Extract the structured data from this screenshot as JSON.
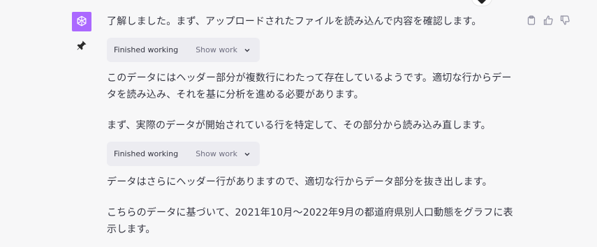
{
  "assistant": {
    "avatar_icon": "openai-logo-icon",
    "avatar_color": "#ab68ff",
    "pin_icon": "pin-icon"
  },
  "message_actions": [
    {
      "icon": "clipboard-icon"
    },
    {
      "icon": "thumbs-up-icon"
    },
    {
      "icon": "thumbs-down-icon"
    }
  ],
  "messages": {
    "p1": "了解しました。まず、アップロードされたファイルを読み込んで内容を確認します。",
    "p2_line1": "このデータにはヘッダー部分が複数行にわたって存在しているようです。適切な行からデー",
    "p2_line2": "タを読み込み、それを基に分析を進める必要があります。",
    "p3": "まず、実際のデータが開始されている行を特定して、その部分から読み込み直します。",
    "p4": "データはさらにヘッダー行がありますので、適切な行からデータ部分を抜き出します。",
    "p5_line1": "こちらのデータに基づいて、2021年10月〜2022年9月の都道府県別人口動態をグラフに表",
    "p5_line2": "示します。"
  },
  "working_chips": [
    {
      "title": "Finished working",
      "action": "Show work"
    },
    {
      "title": "Finished working",
      "action": "Show work"
    }
  ]
}
